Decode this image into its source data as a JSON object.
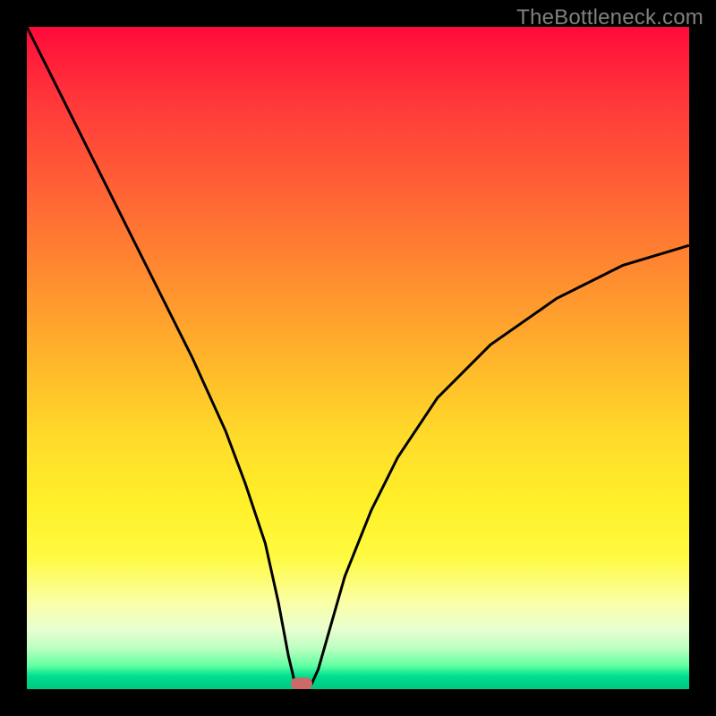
{
  "watermark": "TheBottleneck.com",
  "chart_data": {
    "type": "line",
    "title": "",
    "xlabel": "",
    "ylabel": "",
    "xlim": [
      0,
      100
    ],
    "ylim": [
      0,
      100
    ],
    "x": [
      0,
      5,
      10,
      15,
      20,
      25,
      30,
      33,
      36,
      38,
      39.5,
      40.5,
      42,
      43,
      44,
      46,
      48,
      52,
      56,
      62,
      70,
      80,
      90,
      100
    ],
    "values": [
      100,
      90,
      80,
      70,
      60,
      50,
      39,
      31,
      22,
      13,
      5,
      0.8,
      0.8,
      0.8,
      3,
      10,
      17,
      27,
      35,
      44,
      52,
      59,
      64,
      67
    ],
    "marker": {
      "x": 41.5,
      "y": 0.8
    },
    "background_gradient": {
      "top": "#ff0a3a",
      "mid": "#fff02a",
      "bottom": "#00c880"
    }
  }
}
